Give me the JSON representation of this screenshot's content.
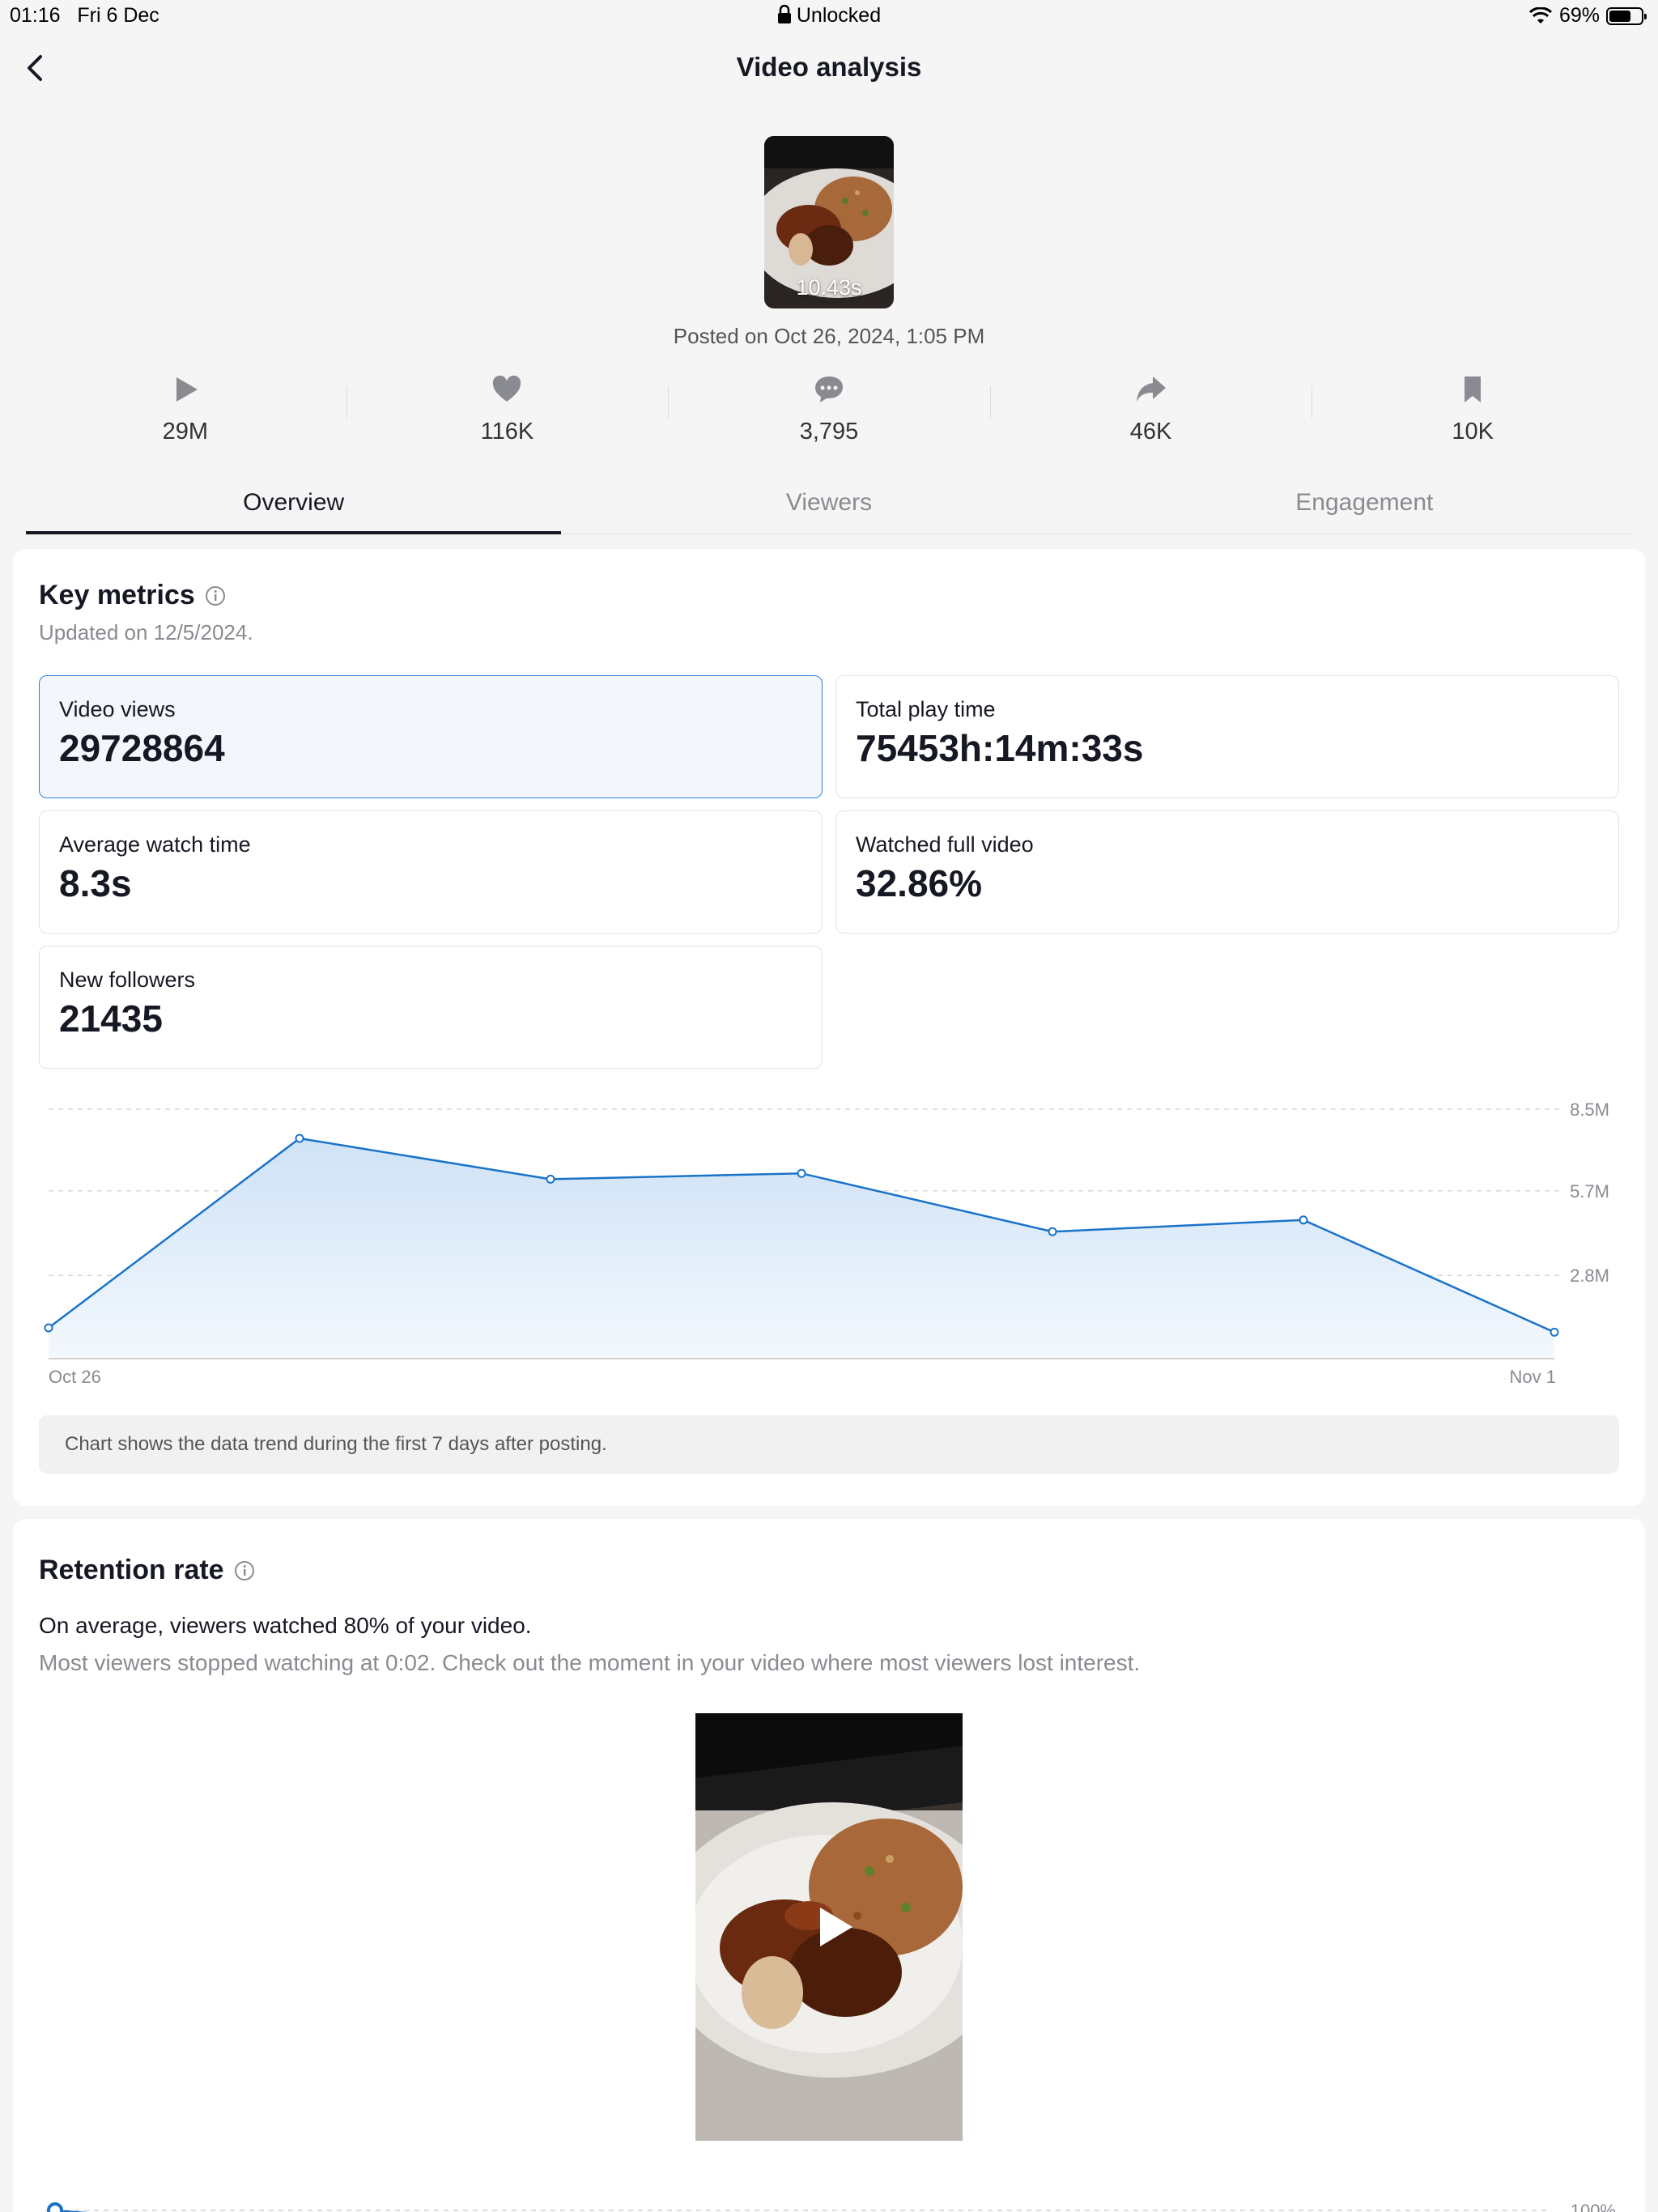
{
  "status_bar": {
    "time": "01:16",
    "date": "Fri 6 Dec",
    "center": "Unlocked",
    "battery": "69%",
    "battery_level": 0.69
  },
  "header": {
    "title": "Video analysis"
  },
  "video": {
    "duration": "10.43s",
    "posted": "Posted on Oct 26, 2024, 1:05 PM"
  },
  "stats": [
    {
      "icon": "play-icon",
      "value": "29M"
    },
    {
      "icon": "heart-icon",
      "value": "116K"
    },
    {
      "icon": "comment-icon",
      "value": "3,795"
    },
    {
      "icon": "share-icon",
      "value": "46K"
    },
    {
      "icon": "bookmark-icon",
      "value": "10K"
    }
  ],
  "tabs": [
    {
      "label": "Overview",
      "active": true
    },
    {
      "label": "Viewers",
      "active": false
    },
    {
      "label": "Engagement",
      "active": false
    }
  ],
  "key_metrics": {
    "title": "Key metrics",
    "updated": "Updated on 12/5/2024.",
    "metrics": [
      {
        "label": "Video views",
        "value": "29728864",
        "selected": true
      },
      {
        "label": "Total play time",
        "value": "75453h:14m:33s",
        "selected": false
      },
      {
        "label": "Average watch time",
        "value": "8.3s",
        "selected": false
      },
      {
        "label": "Watched full video",
        "value": "32.86%",
        "selected": false
      },
      {
        "label": "New followers",
        "value": "21435",
        "selected": false
      }
    ],
    "note": "Chart shows the data trend during the first 7 days after posting."
  },
  "chart_data": {
    "type": "area",
    "title": "",
    "xlabel": "",
    "ylabel": "",
    "x": [
      "Oct 26",
      "Oct 27",
      "Oct 28",
      "Oct 29",
      "Oct 30",
      "Oct 31",
      "Nov 1"
    ],
    "x_tick_labels": [
      "Oct 26",
      "Nov 1"
    ],
    "y_ticks": [
      {
        "value": 2800000,
        "label": "2.8M"
      },
      {
        "value": 5700000,
        "label": "5.7M"
      },
      {
        "value": 8500000,
        "label": "8.5M"
      }
    ],
    "ylim": [
      0,
      8500000
    ],
    "grid": true,
    "color": "#1a73c9",
    "series": [
      {
        "values": [
          1000000,
          7500000,
          6100000,
          6300000,
          4300000,
          4700000,
          850000
        ]
      }
    ]
  },
  "retention": {
    "title": "Retention rate",
    "summary": "On average, viewers watched 80% of your video.",
    "detail": "Most viewers stopped watching at 0:02. Check out the moment in your video where most viewers lost interest.",
    "y_tick_label": "100%"
  },
  "colors": {
    "accent": "#1a73c9",
    "selected_bg": "#f3f7fd",
    "text": "#161823",
    "muted": "#8a8b91"
  }
}
